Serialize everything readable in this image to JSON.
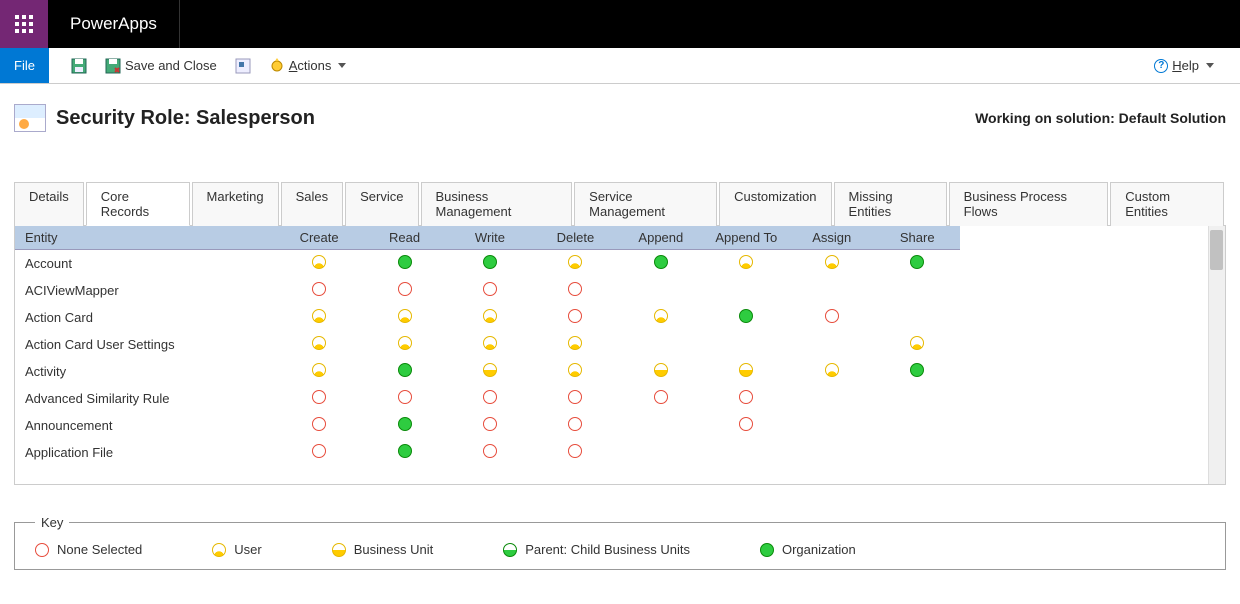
{
  "brand": "PowerApps",
  "toolbar": {
    "file": "File",
    "saveClose": "Save and Close",
    "actions_prefix": "A",
    "actions_rest": "ctions",
    "help_prefix": "H",
    "help_rest": "elp"
  },
  "header": {
    "title": "Security Role: Salesperson",
    "solution": "Working on solution: Default Solution"
  },
  "tabs": [
    "Details",
    "Core Records",
    "Marketing",
    "Sales",
    "Service",
    "Business Management",
    "Service Management",
    "Customization",
    "Missing Entities",
    "Business Process Flows",
    "Custom Entities"
  ],
  "activeTab": 1,
  "gridHeaders": [
    "Entity",
    "Create",
    "Read",
    "Write",
    "Delete",
    "Append",
    "Append To",
    "Assign",
    "Share"
  ],
  "entities": [
    {
      "name": "Account",
      "perms": [
        "user",
        "org",
        "org",
        "user",
        "org",
        "user",
        "user",
        "org"
      ]
    },
    {
      "name": "ACIViewMapper",
      "perms": [
        "none",
        "none",
        "none",
        "none",
        "",
        "",
        "",
        ""
      ]
    },
    {
      "name": "Action Card",
      "perms": [
        "user",
        "user",
        "user",
        "none",
        "user",
        "org",
        "none",
        ""
      ]
    },
    {
      "name": "Action Card User Settings",
      "perms": [
        "user",
        "user",
        "user",
        "user",
        "",
        "",
        "",
        "user"
      ]
    },
    {
      "name": "Activity",
      "perms": [
        "user",
        "org",
        "bu",
        "user",
        "bu",
        "bu",
        "user",
        "org"
      ]
    },
    {
      "name": "Advanced Similarity Rule",
      "perms": [
        "none",
        "none",
        "none",
        "none",
        "none",
        "none",
        "",
        ""
      ]
    },
    {
      "name": "Announcement",
      "perms": [
        "none",
        "org",
        "none",
        "none",
        "",
        "none",
        "",
        ""
      ]
    },
    {
      "name": "Application File",
      "perms": [
        "none",
        "org",
        "none",
        "none",
        "",
        "",
        "",
        ""
      ]
    }
  ],
  "key": {
    "legend": "Key",
    "items": [
      {
        "level": "none",
        "label": "None Selected"
      },
      {
        "level": "user",
        "label": "User"
      },
      {
        "level": "bu",
        "label": "Business Unit"
      },
      {
        "level": "parent",
        "label": "Parent: Child Business Units"
      },
      {
        "level": "org",
        "label": "Organization"
      }
    ]
  }
}
